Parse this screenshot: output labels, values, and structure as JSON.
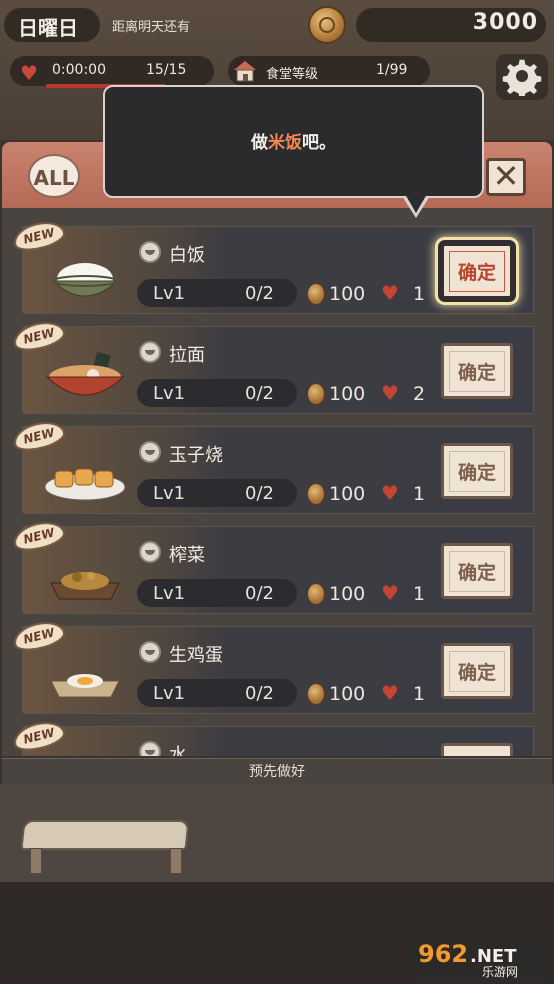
{
  "hud": {
    "day": "日曜日",
    "until_label": "距离明天还有",
    "money": "3000",
    "timer": "0:00:00",
    "count": "15/15",
    "level_label": "食堂等级",
    "level_value": "1/99"
  },
  "panel": {
    "all_label": "ALL",
    "close_label": "✕"
  },
  "tooltip": {
    "prefix": "做",
    "highlight": "米饭",
    "suffix": "吧。"
  },
  "dishes": [
    {
      "new": "NEW",
      "name": "白饭",
      "level": "Lv1",
      "progress": "0/2",
      "price": "100",
      "hearts": "1",
      "confirm": "确定"
    },
    {
      "new": "NEW",
      "name": "拉面",
      "level": "Lv1",
      "progress": "0/2",
      "price": "100",
      "hearts": "2",
      "confirm": "确定"
    },
    {
      "new": "NEW",
      "name": "玉子烧",
      "level": "Lv1",
      "progress": "0/2",
      "price": "100",
      "hearts": "1",
      "confirm": "确定"
    },
    {
      "new": "NEW",
      "name": "榨菜",
      "level": "Lv1",
      "progress": "0/2",
      "price": "100",
      "hearts": "1",
      "confirm": "确定"
    },
    {
      "new": "NEW",
      "name": "生鸡蛋",
      "level": "Lv1",
      "progress": "0/2",
      "price": "100",
      "hearts": "1",
      "confirm": "确定"
    },
    {
      "new": "NEW",
      "name": "水",
      "level": "",
      "progress": "",
      "price": "",
      "hearts": "",
      "confirm": ""
    }
  ],
  "bottom": {
    "prep_label": "预先做好",
    "watermark": "962.NET",
    "watermark_sub": "乐游网"
  },
  "colors": {
    "accent_red": "#c94a3a",
    "header_pink": "#c07a66",
    "highlight": "#ef8a55",
    "glow": "#f3e2a8"
  }
}
